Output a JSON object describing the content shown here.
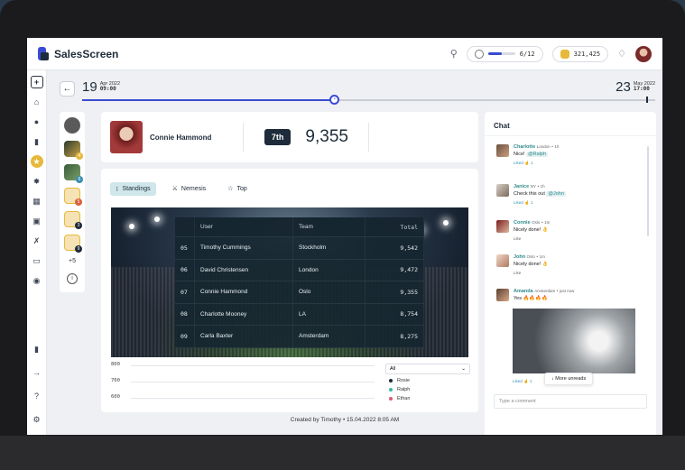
{
  "app": {
    "name": "SalesScreen"
  },
  "header": {
    "progress_text": "6/12",
    "progress_fraction": 0.5,
    "coins": "321,425"
  },
  "timeline": {
    "start": {
      "day": "19",
      "month_year": "Apr 2022",
      "time": "09:00"
    },
    "end": {
      "day": "23",
      "month_year": "May 2022",
      "time": "17:00"
    },
    "progress_fraction": 0.44
  },
  "leaderboard_avatars": {
    "more_label": "+5",
    "badges": [
      "4",
      "6",
      "5",
      "3",
      "9",
      "8"
    ]
  },
  "profile": {
    "name": "Connie Hammond",
    "rank": "7th",
    "score": "9,355"
  },
  "tabs": [
    {
      "label": "Standings",
      "icon": "standings-icon",
      "active": true
    },
    {
      "label": "Nemesis",
      "icon": "nemesis-icon",
      "active": false
    },
    {
      "label": "Top",
      "icon": "trophy-icon",
      "active": false
    }
  ],
  "standings": {
    "columns": [
      "User",
      "Team",
      "Total"
    ],
    "rows": [
      {
        "rank": "05",
        "user": "Timothy Cummings",
        "team": "Stockholm",
        "total": "9,542"
      },
      {
        "rank": "06",
        "user": "David Christensen",
        "team": "London",
        "total": "9,472"
      },
      {
        "rank": "07",
        "user": "Connie Hammond",
        "team": "Oslo",
        "total": "9,355"
      },
      {
        "rank": "08",
        "user": "Charlotte Mooney",
        "team": "LA",
        "total": "8,754"
      },
      {
        "rank": "09",
        "user": "Carla Baxter",
        "team": "Amsterdam",
        "total": "8,275"
      }
    ]
  },
  "chart": {
    "yticks": [
      "800",
      "700",
      "600"
    ],
    "filter": "All",
    "legend": [
      {
        "name": "Rosie",
        "color": "#1e2b3a"
      },
      {
        "name": "Ralph",
        "color": "#3bb6a6"
      },
      {
        "name": "Ethan",
        "color": "#e05a7a"
      }
    ]
  },
  "chat": {
    "title": "Chat",
    "messages": [
      {
        "name": "Charlotte",
        "location": "London",
        "time": "1h",
        "text": "Nice!",
        "mention": "@Ralph",
        "liked": "Liked",
        "likes": "1"
      },
      {
        "name": "Janice",
        "location": "NY",
        "time": "1h",
        "text": "Check this out",
        "mention": "@John",
        "liked": "Liked",
        "likes": "1"
      },
      {
        "name": "Connie",
        "location": "Oslo",
        "time": "1m",
        "text": "Nicely done! 👌",
        "like": "Like"
      },
      {
        "name": "John",
        "location": "Oslo",
        "time": "1m",
        "text": "Nicely done! 👌",
        "like": "Like"
      },
      {
        "name": "Amanda",
        "location": "Amsterdam",
        "time": "just now",
        "text": "Yes 🔥🔥🔥🔥",
        "liked": "Liked",
        "likes": "1"
      }
    ],
    "more_unreads": "More unreads",
    "input_placeholder": "Type a comment"
  },
  "footer": {
    "created_by": "Created by Timothy • 15.04.2022 8:05 AM"
  },
  "colors": {
    "brand": "#3a4bd1",
    "dark": "#1e2b3a",
    "accent_teal": "#2f8a8a",
    "gold": "#e6b93a"
  }
}
